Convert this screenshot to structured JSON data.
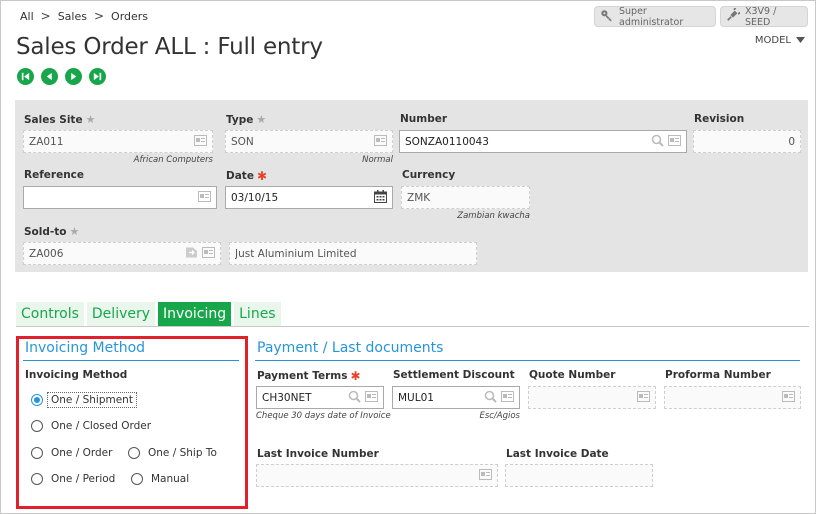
{
  "breadcrumb": [
    "All",
    "Sales",
    "Orders"
  ],
  "header": {
    "user_button": "Super administrator",
    "folder_button": "X3V9 / SEED",
    "title": "Sales Order ALL : Full entry",
    "model_label": "MODEL"
  },
  "nav_icons": [
    "first-record-icon",
    "previous-record-icon",
    "next-record-icon",
    "last-record-icon"
  ],
  "form": {
    "sales_site": {
      "label": "Sales Site",
      "value": "ZA011",
      "sub": "African Computers"
    },
    "type": {
      "label": "Type",
      "value": "SON",
      "sub": "Normal"
    },
    "number": {
      "label": "Number",
      "value": "SONZA0110043"
    },
    "revision": {
      "label": "Revision",
      "value": "0"
    },
    "reference": {
      "label": "Reference",
      "value": ""
    },
    "date": {
      "label": "Date",
      "value": "03/10/15"
    },
    "currency": {
      "label": "Currency",
      "value": "ZMK",
      "sub": "Zambian kwacha"
    },
    "sold_to": {
      "label": "Sold-to",
      "value": "ZA006",
      "name": "Just Aluminium Limited"
    }
  },
  "tabs": [
    {
      "label": "Controls",
      "active": false
    },
    {
      "label": "Delivery",
      "active": false
    },
    {
      "label": "Invoicing",
      "active": true
    },
    {
      "label": "Lines",
      "active": false
    }
  ],
  "invoicing": {
    "section_title": "Invoicing Method",
    "field_label": "Invoicing Method",
    "options": [
      "One / Shipment",
      "One / Closed Order",
      "One / Order",
      "One / Ship To",
      "One / Period",
      "Manual"
    ],
    "selected": "One / Shipment"
  },
  "payment": {
    "section_title": "Payment / Last documents",
    "payment_terms": {
      "label": "Payment Terms",
      "value": "CH30NET",
      "sub": "Cheque 30 days date of Invoice"
    },
    "settlement_discount": {
      "label": "Settlement Discount",
      "value": "MUL01",
      "sub": "Esc/Agios"
    },
    "quote_number": {
      "label": "Quote Number",
      "value": ""
    },
    "proforma_number": {
      "label": "Proforma Number",
      "value": ""
    },
    "last_invoice_number": {
      "label": "Last Invoice Number",
      "value": ""
    },
    "last_invoice_date": {
      "label": "Last Invoice Date",
      "value": ""
    }
  },
  "colors": {
    "accent_green": "#17a74a",
    "section_blue": "#2796d8",
    "highlight_red": "#e0202a"
  }
}
